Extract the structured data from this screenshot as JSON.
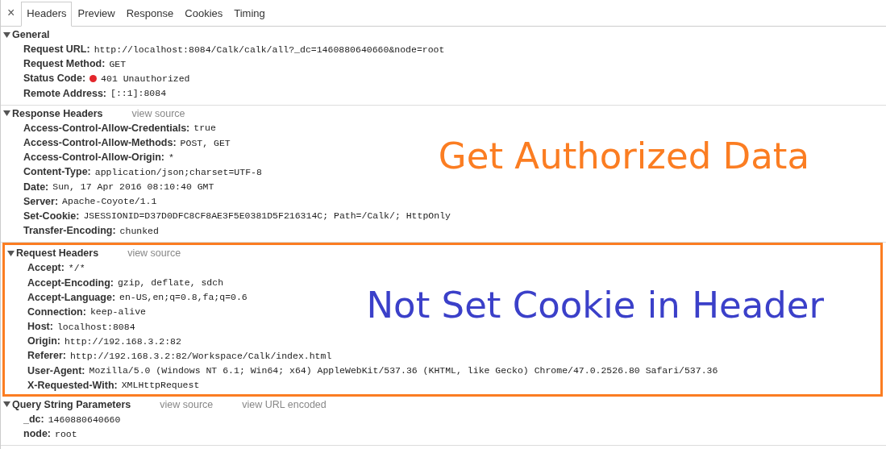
{
  "tabs": {
    "close": "×",
    "items": [
      {
        "label": "Headers",
        "selected": true
      },
      {
        "label": "Preview",
        "selected": false
      },
      {
        "label": "Response",
        "selected": false
      },
      {
        "label": "Cookies",
        "selected": false
      },
      {
        "label": "Timing",
        "selected": false
      }
    ]
  },
  "sections": [
    {
      "title": "General",
      "expanded": true,
      "highlighted": false,
      "rows": [
        {
          "name": "Request URL:",
          "value": "http://localhost:8084/Calk/calk/all?_dc=1460880640660&node=root"
        },
        {
          "name": "Request Method:",
          "value": "GET"
        },
        {
          "name": "Status Code:",
          "value": "401 Unauthorized",
          "color": "#e3262b"
        },
        {
          "name": "Remote Address:",
          "value": "[::1]:8084"
        }
      ]
    },
    {
      "title": "Response Headers",
      "expanded": true,
      "highlighted": false,
      "links": [
        "view source"
      ],
      "annotation": {
        "text": "Get Authorized Data",
        "color": "#fb7d22"
      },
      "rows": [
        {
          "name": "Access-Control-Allow-Credentials:",
          "value": "true"
        },
        {
          "name": "Access-Control-Allow-Methods:",
          "value": "POST, GET"
        },
        {
          "name": "Access-Control-Allow-Origin:",
          "value": "*"
        },
        {
          "name": "Content-Type:",
          "value": "application/json;charset=UTF-8"
        },
        {
          "name": "Date:",
          "value": "Sun, 17 Apr 2016 08:10:40 GMT"
        },
        {
          "name": "Server:",
          "value": "Apache-Coyote/1.1"
        },
        {
          "name": "Set-Cookie:",
          "value": "JSESSIONID=D37D0DFC8CF8AE3F5E0381D5F216314C; Path=/Calk/; HttpOnly"
        },
        {
          "name": "Transfer-Encoding:",
          "value": "chunked"
        }
      ]
    },
    {
      "title": "Request Headers",
      "expanded": true,
      "highlighted": true,
      "links": [
        "view source"
      ],
      "annotation": {
        "text": "Not Set Cookie in Header",
        "color": "#3b40c9"
      },
      "rows": [
        {
          "name": "Accept:",
          "value": "*/*"
        },
        {
          "name": "Accept-Encoding:",
          "value": "gzip, deflate, sdch"
        },
        {
          "name": "Accept-Language:",
          "value": "en-US,en;q=0.8,fa;q=0.6"
        },
        {
          "name": "Connection:",
          "value": "keep-alive"
        },
        {
          "name": "Host:",
          "value": "localhost:8084"
        },
        {
          "name": "Origin:",
          "value": "http://192.168.3.2:82"
        },
        {
          "name": "Referer:",
          "value": "http://192.168.3.2:82/Workspace/Calk/index.html"
        },
        {
          "name": "User-Agent:",
          "value": "Mozilla/5.0 (Windows NT 6.1; Win64; x64) AppleWebKit/537.36 (KHTML, like Gecko) Chrome/47.0.2526.80 Safari/537.36"
        },
        {
          "name": "X-Requested-With:",
          "value": "XMLHttpRequest"
        }
      ]
    },
    {
      "title": "Query String Parameters",
      "expanded": true,
      "highlighted": false,
      "links": [
        "view source",
        "view URL encoded"
      ],
      "rows": [
        {
          "name": "_dc:",
          "value": "1460880640660"
        },
        {
          "name": "node:",
          "value": "root"
        }
      ]
    }
  ]
}
